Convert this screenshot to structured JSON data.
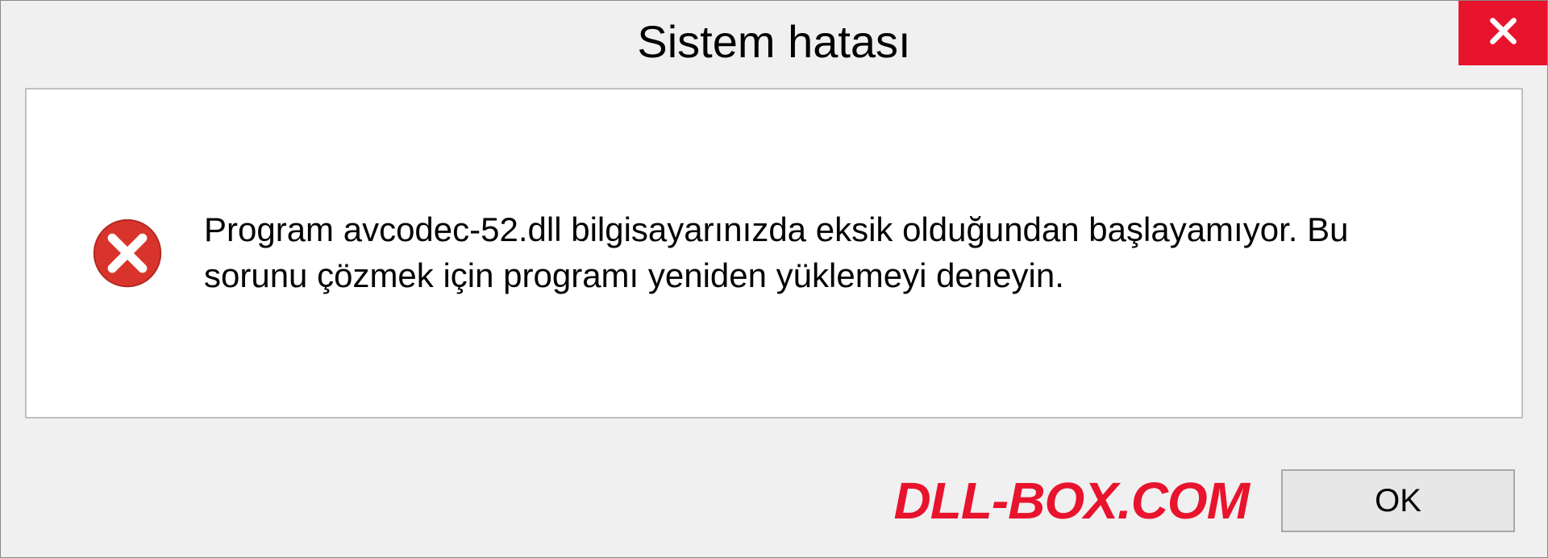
{
  "dialog": {
    "title": "Sistem hatası",
    "message": "Program avcodec-52.dll bilgisayarınızda eksik olduğundan başlayamıyor. Bu sorunu çözmek için programı yeniden yüklemeyi deneyin.",
    "ok_label": "OK"
  },
  "watermark": "DLL-BOX.COM",
  "colors": {
    "accent_red": "#e8132c",
    "background": "#f0f0f0",
    "border": "#c0c0c0"
  }
}
